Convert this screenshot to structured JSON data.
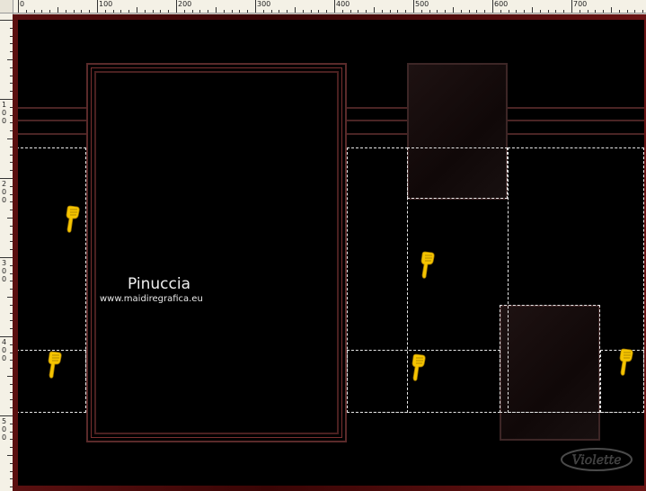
{
  "ruler": {
    "top_labels": [
      "0",
      "100",
      "200",
      "300",
      "400",
      "500",
      "600",
      "700"
    ],
    "left_labels": [
      "1\n0\n0",
      "2\n0\n0",
      "3\n0\n0",
      "4\n0\n0",
      "5\n0\n0"
    ]
  },
  "canvas": {
    "name_text": "Pinuccia",
    "url_text": "www.maidiregrafica.eu",
    "watermark_text": "Violette"
  },
  "colors": {
    "frame_border": "#5a1a1a",
    "canvas_bg": "#000000",
    "pointer": "#f5c400",
    "selection": "#e8e8e8"
  },
  "icons": [
    "pointer-hand-icon",
    "pointer-hand-icon",
    "pointer-hand-icon",
    "pointer-hand-icon",
    "pointer-hand-icon"
  ]
}
